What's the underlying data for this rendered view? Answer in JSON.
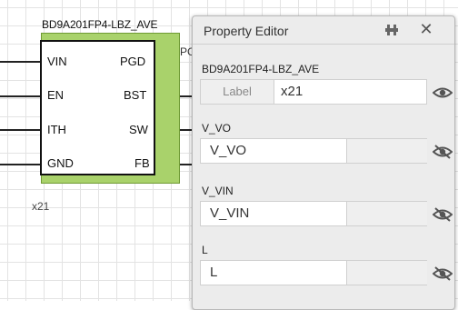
{
  "schematic": {
    "component_name": "BD9A201FP4-LBZ_AVE",
    "ref": "x21",
    "right_fragment": "PG",
    "pins_left": [
      "VIN",
      "EN",
      "ITH",
      "GND"
    ],
    "pins_right": [
      "PGD",
      "BST",
      "SW",
      "FB"
    ],
    "body_color": "#a9d26b"
  },
  "panel": {
    "title": "Property Editor",
    "icons": {
      "pin": "pin-icon",
      "close": "close-icon"
    },
    "component_label": "BD9A201FP4-LBZ_AVE",
    "label_row": {
      "tag": "Label",
      "value": "x21",
      "visibility": "visible"
    },
    "properties": [
      {
        "name": "V_VO",
        "value": "V_VO",
        "visibility": "hidden"
      },
      {
        "name": "V_VIN",
        "value": "V_VIN",
        "visibility": "hidden"
      },
      {
        "name": "L",
        "value": "L",
        "visibility": "hidden"
      }
    ]
  }
}
